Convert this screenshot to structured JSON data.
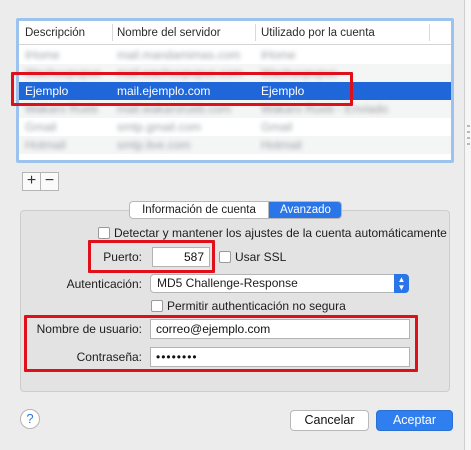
{
  "table": {
    "headers": [
      "Descripción",
      "Nombre del servidor",
      "Utilizado por la cuenta"
    ],
    "rows": [
      {
        "desc": "iHome",
        "server": "mail.mandamimas.com",
        "account": "iHome",
        "blurred": true,
        "selected": false
      },
      {
        "desc": "Wachuupupuc",
        "server": "mail.wachuupupuc.com",
        "account": "Wachuupupuc",
        "blurred": true,
        "selected": false
      },
      {
        "desc": "Ejemplo",
        "server": "mail.ejemplo.com",
        "account": "Ejemplo",
        "blurred": false,
        "selected": true
      },
      {
        "desc": "Wakaro Rueb",
        "server": "mail.wakarorueb.com",
        "account": "Wakaro Rueb - Enviado",
        "blurred": true,
        "selected": false
      },
      {
        "desc": "Gmail",
        "server": "smtp.gmail.com",
        "account": "Gmail",
        "blurred": true,
        "selected": false
      },
      {
        "desc": "Hotmail",
        "server": "smtp.live.com",
        "account": "Hotmail",
        "blurred": true,
        "selected": false
      }
    ]
  },
  "controls": {
    "add_label": "+",
    "remove_label": "−"
  },
  "tabs": {
    "account_info": "Información de cuenta",
    "advanced": "Avanzado",
    "active": "advanced"
  },
  "advanced": {
    "auto_detect_label": "Detectar y mantener los ajustes de la cuenta automáticamente",
    "auto_detect_checked": false,
    "port_label": "Puerto:",
    "port_value": "587",
    "use_ssl_label": "Usar SSL",
    "use_ssl_checked": false,
    "auth_label": "Autenticación:",
    "auth_value": "MD5 Challenge-Response",
    "allow_insecure_label": "Permitir authenticación no segura",
    "allow_insecure_checked": false,
    "username_label": "Nombre de usuario:",
    "username_value": "correo@ejemplo.com",
    "password_label": "Contraseña:",
    "password_value": "••••••••"
  },
  "footer": {
    "help_label": "?",
    "cancel_label": "Cancelar",
    "accept_label": "Aceptar"
  },
  "colors": {
    "accent": "#2a76e8",
    "selection": "#1f66d9",
    "highlight_red": "#e0101b"
  }
}
